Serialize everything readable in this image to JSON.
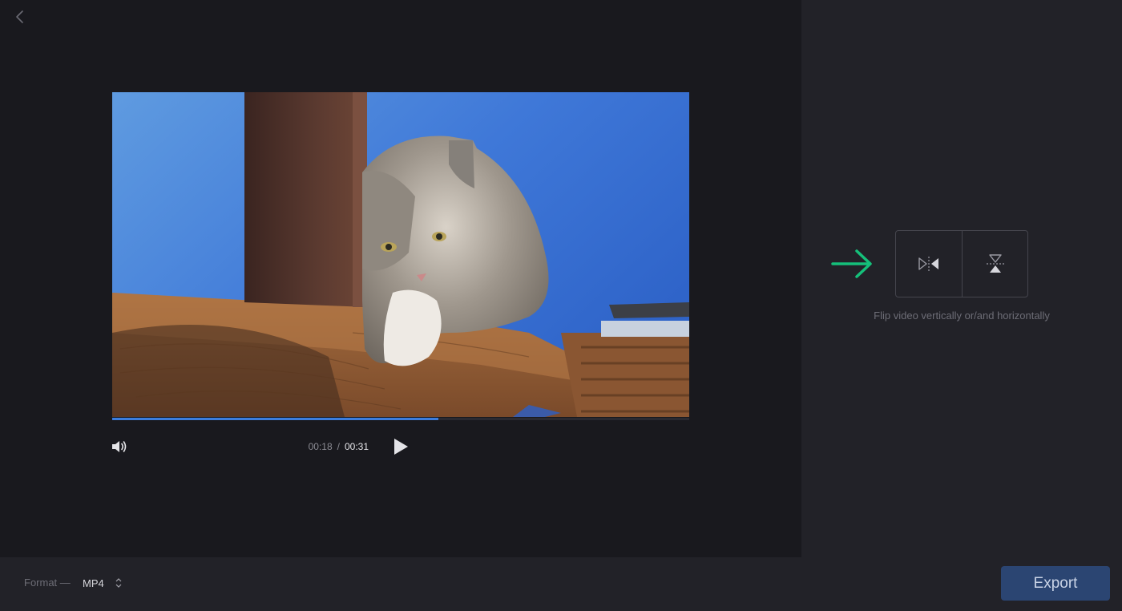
{
  "nav": {
    "back_icon": "chevron-left-icon"
  },
  "player": {
    "current_time": "00:18",
    "separator": "/",
    "total_time": "00:31",
    "progress_fraction": 0.565,
    "progress_color": "#3b7ddd",
    "volume_icon": "speaker-icon",
    "play_icon": "play-icon"
  },
  "flip_panel": {
    "hint_icon": "arrow-right-icon",
    "hint_color": "#15c07a",
    "flip_horizontal_icon": "flip-horizontal-icon",
    "flip_vertical_icon": "flip-vertical-icon",
    "caption": "Flip video vertically or/and horizontally"
  },
  "footer": {
    "format_label": "Format —",
    "format_value": "MP4",
    "export_label": "Export",
    "export_color": "#2b4572"
  }
}
